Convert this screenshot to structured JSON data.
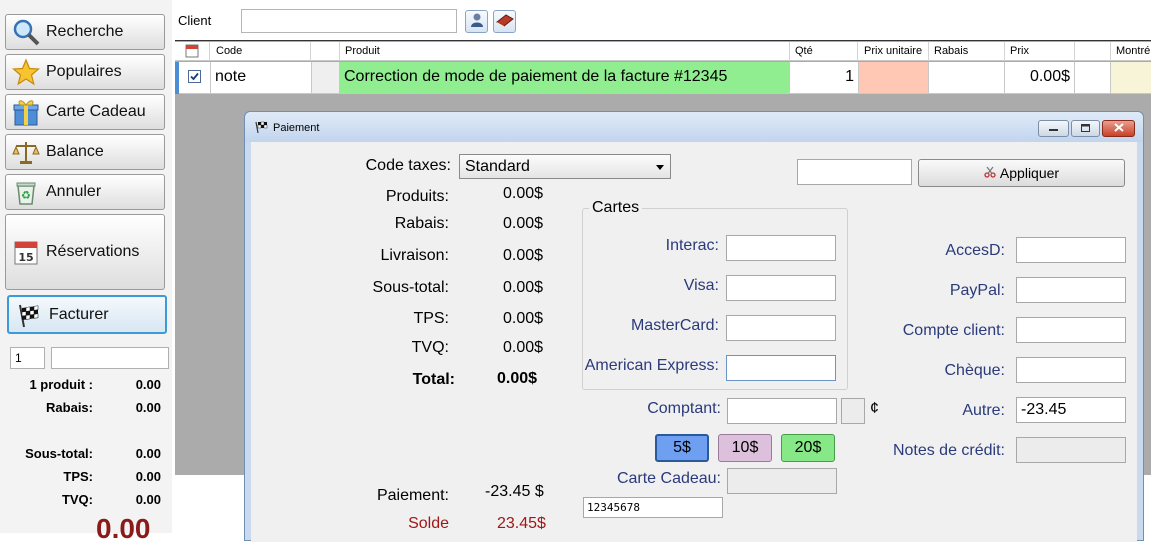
{
  "sidebar": {
    "buttons": [
      {
        "label": "Recherche",
        "icon": "magnifier-icon"
      },
      {
        "label": "Populaires",
        "icon": "star-icon"
      },
      {
        "label": "Carte Cadeau",
        "icon": "gift-icon"
      },
      {
        "label": "Balance",
        "icon": "scale-icon"
      },
      {
        "label": "Annuler",
        "icon": "recycle-icon"
      },
      {
        "label": "Réservations",
        "icon": "calendar-icon"
      },
      {
        "label": "Facturer",
        "icon": "checkered-flag-icon"
      }
    ],
    "qty_value": "1",
    "code_value": "",
    "summary": [
      {
        "label": "1 produit :",
        "value": "0.00"
      },
      {
        "label": "Rabais:",
        "value": "0.00"
      },
      {
        "label": "Sous-total:",
        "value": "0.00"
      },
      {
        "label": "TPS:",
        "value": "0.00"
      },
      {
        "label": "TVQ:",
        "value": "0.00"
      }
    ],
    "grand_total": "0.00"
  },
  "client": {
    "label": "Client",
    "value": ""
  },
  "grid": {
    "headers": [
      "Code",
      "Produit",
      "Qté",
      "Prix unitaire",
      "Rabais",
      "Prix",
      "Montré"
    ],
    "row": {
      "checked": true,
      "code": "note",
      "product": "Correction de mode de paiement de la facture #12345",
      "qty": "1",
      "unit_price": "",
      "discount": "",
      "price": "0.00$"
    }
  },
  "dialog": {
    "title": "Paiement",
    "tax_code_label": "Code taxes:",
    "tax_code_value": "Standard",
    "apply_input": "",
    "apply_label": "Appliquer",
    "totals": [
      {
        "label": "Produits:",
        "value": "0.00$"
      },
      {
        "label": "Rabais:",
        "value": "0.00$"
      },
      {
        "label": "Livraison:",
        "value": "0.00$"
      },
      {
        "label": "Sous-total:",
        "value": "0.00$"
      },
      {
        "label": "TPS:",
        "value": "0.00$"
      },
      {
        "label": "TVQ:",
        "value": "0.00$"
      }
    ],
    "total_label": "Total:",
    "total_value": "0.00$",
    "cards_group": "Cartes",
    "cards": [
      {
        "label": "Interac:",
        "value": ""
      },
      {
        "label": "Visa:",
        "value": ""
      },
      {
        "label": "MasterCard:",
        "value": ""
      },
      {
        "label": "American Express:",
        "value": ""
      }
    ],
    "cash_label": "Comptant:",
    "cash_value": "",
    "cents_symbol": "¢",
    "cash_buttons": [
      {
        "label": "5$",
        "color": "#6f9ff0"
      },
      {
        "label": "10$",
        "color": "#dcc0dc"
      },
      {
        "label": "20$",
        "color": "#86e886"
      }
    ],
    "gift_card_label": "Carte Cadeau:",
    "gift_card_value": "",
    "gift_card_number": "12345678",
    "right_methods": [
      {
        "label": "AccesD:",
        "value": ""
      },
      {
        "label": "PayPal:",
        "value": ""
      },
      {
        "label": "Compte client:",
        "value": ""
      },
      {
        "label": "Chèque:",
        "value": ""
      },
      {
        "label": "Autre:",
        "value": "-23.45"
      }
    ],
    "credit_notes_label": "Notes de crédit:",
    "credit_notes_value": "",
    "payment_label": "Paiement:",
    "payment_value": "-23.45 $",
    "balance_label": "Solde",
    "balance_value": "23.45$"
  },
  "colors": {
    "product_cell": "#90ee90",
    "unit_price_cell": "#ffc8b4",
    "balance_text": "#a01818",
    "method_label": "#2a3a7a",
    "active_button_border": "#3c9ad8"
  }
}
